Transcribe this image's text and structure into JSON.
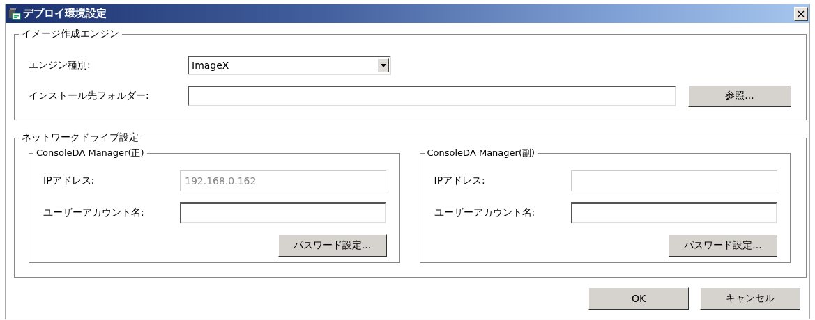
{
  "window": {
    "title": "デプロイ環境設定",
    "close": "×"
  },
  "image_engine": {
    "title": "イメージ作成エンジン",
    "engine_type": {
      "label": "エンジン種別:",
      "value": "ImageX"
    },
    "install_folder": {
      "label": "インストール先フォルダー:",
      "button": "参照..."
    }
  },
  "network_drive": {
    "title": "ネットワークドライブ設定",
    "managers": [
      {
        "title": "ConsoleDA Manager(正)",
        "ip": {
          "label": "IPアドレス:",
          "value": "192.168.0.162",
          "disabled": true
        },
        "account": {
          "label": "ユーザーアカウント名:",
          "disabled": false
        },
        "button": "パスワード設定..."
      },
      {
        "title": "ConsoleDA Manager(副)",
        "ip": {
          "label": "IPアドレス:",
          "disabled": true
        },
        "account": {
          "label": "ユーザーアカウント名:",
          "disabled": false
        },
        "button": "パスワード設定..."
      }
    ]
  },
  "buttons": [
    "OK",
    "キャンセル"
  ]
}
